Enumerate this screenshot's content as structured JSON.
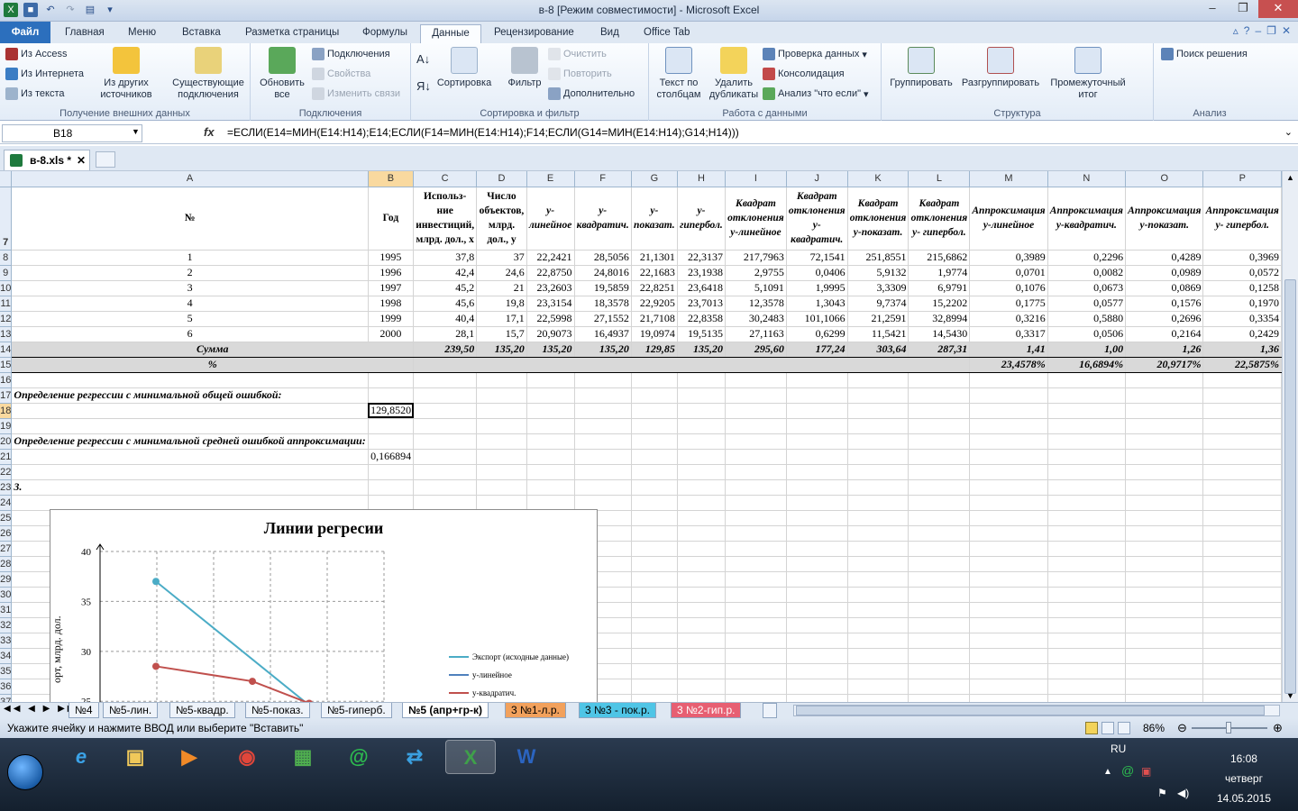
{
  "window": {
    "title": "в-8  [Режим совместимости] - Microsoft Excel"
  },
  "ribbon_tabs": [
    "Файл",
    "Главная",
    "Меню",
    "Вставка",
    "Разметка страницы",
    "Формулы",
    "Данные",
    "Рецензирование",
    "Вид",
    "Office Tab"
  ],
  "ribbon": {
    "ext_data": {
      "access": "Из Access",
      "web": "Из Интернета",
      "text": "Из текста",
      "other": "Из других источников",
      "existing": "Существующие подключения",
      "label": "Получение внешних данных"
    },
    "connections": {
      "refresh": "Обновить все",
      "conn": "Подключения",
      "props": "Свойства",
      "edit": "Изменить связи",
      "label": "Подключения"
    },
    "sortfilter": {
      "sort": "Сортировка",
      "filter": "Фильтр",
      "clear": "Очистить",
      "reapply": "Повторить",
      "advanced": "Дополнительно",
      "label": "Сортировка и фильтр"
    },
    "datatools": {
      "text_cols": "Текст по столбцам",
      "dups": "Удалить дубликаты",
      "validation": "Проверка данных",
      "consolidate": "Консолидация",
      "whatif": "Анализ \"что если\"",
      "label": "Работа с данными"
    },
    "outline": {
      "group": "Группировать",
      "ungroup": "Разгруппировать",
      "subtotal": "Промежуточный итог",
      "label": "Структура"
    },
    "analysis": {
      "solver": "Поиск решения",
      "label": "Анализ"
    }
  },
  "formula_bar": {
    "name_box": "B18",
    "fx": "fx",
    "formula": "=ЕСЛИ(E14=МИН(E14:H14);E14;ЕСЛИ(F14=МИН(E14:H14);F14;ЕСЛИ(G14=МИН(E14:H14);G14;H14)))"
  },
  "workbook_tab": "в-8.xls *",
  "columns": [
    "A",
    "B",
    "C",
    "D",
    "E",
    "F",
    "G",
    "H",
    "I",
    "J",
    "K",
    "L",
    "M",
    "N",
    "O",
    "P"
  ],
  "header_row": {
    "num": "7",
    "cells": [
      "№",
      "Год",
      "Использ-ние инвестиций, млрд. дол., x",
      "Число объектов, млрд. дол., y",
      "y-линейное",
      "y-квадратич.",
      "y-показат.",
      "y- гипербол.",
      "Квадрат отклонения y-линейное",
      "Квадрат отклонения y-квадратич.",
      "Квадрат отклонения y-показат.",
      "Квадрат отклонения y- гипербол.",
      "Аппроксимация y-линейное",
      "Аппроксимация y-квадратич.",
      "Аппроксимация y-показат.",
      "Аппроксимация y- гипербол."
    ]
  },
  "data_rows": [
    {
      "num": "8",
      "cells": [
        "1",
        "1995",
        "37,8",
        "37",
        "22,2421",
        "28,5056",
        "21,1301",
        "22,3137",
        "217,7963",
        "72,1541",
        "251,8551",
        "215,6862",
        "0,3989",
        "0,2296",
        "0,4289",
        "0,3969"
      ]
    },
    {
      "num": "9",
      "cells": [
        "2",
        "1996",
        "42,4",
        "24,6",
        "22,8750",
        "24,8016",
        "22,1683",
        "23,1938",
        "2,9755",
        "0,0406",
        "5,9132",
        "1,9774",
        "0,0701",
        "0,0082",
        "0,0989",
        "0,0572"
      ]
    },
    {
      "num": "10",
      "cells": [
        "3",
        "1997",
        "45,2",
        "21",
        "23,2603",
        "19,5859",
        "22,8251",
        "23,6418",
        "5,1091",
        "1,9995",
        "3,3309",
        "6,9791",
        "0,1076",
        "0,0673",
        "0,0869",
        "0,1258"
      ]
    },
    {
      "num": "11",
      "cells": [
        "4",
        "1998",
        "45,6",
        "19,8",
        "23,3154",
        "18,3578",
        "22,9205",
        "23,7013",
        "12,3578",
        "1,3043",
        "9,7374",
        "15,2202",
        "0,1775",
        "0,0577",
        "0,1576",
        "0,1970"
      ]
    },
    {
      "num": "12",
      "cells": [
        "5",
        "1999",
        "40,4",
        "17,1",
        "22,5998",
        "27,1552",
        "21,7108",
        "22,8358",
        "30,2483",
        "101,1066",
        "21,2591",
        "32,8994",
        "0,3216",
        "0,5880",
        "0,2696",
        "0,3354"
      ]
    },
    {
      "num": "13",
      "cells": [
        "6",
        "2000",
        "28,1",
        "15,7",
        "20,9073",
        "16,4937",
        "19,0974",
        "19,5135",
        "27,1163",
        "0,6299",
        "11,5421",
        "14,5430",
        "0,3317",
        "0,0506",
        "0,2164",
        "0,2429"
      ]
    }
  ],
  "sum_row": {
    "num": "14",
    "label": "Сумма",
    "cells": [
      "239,50",
      "135,20",
      "135,20",
      "135,20",
      "129,85",
      "135,20",
      "295,60",
      "177,24",
      "303,64",
      "287,31",
      "1,41",
      "1,00",
      "1,26",
      "1,36"
    ]
  },
  "pct_row": {
    "num": "15",
    "label": "%",
    "cells": [
      "23,4578%",
      "16,6894%",
      "20,9717%",
      "22,5875%"
    ]
  },
  "notes": {
    "r17": "Определение регрессии с минимальной общей ошибкой:",
    "r18": "129,8520",
    "r20": "Определение регрессии с минимальной средней ошибкой аппроксимации:",
    "r21": "0,166894",
    "r23": "3."
  },
  "row_numbers_tail": [
    "16",
    "17",
    "18",
    "19",
    "20",
    "21",
    "22",
    "23",
    "24",
    "25",
    "26",
    "27",
    "28",
    "29",
    "30",
    "31",
    "32",
    "33",
    "34",
    "35",
    "36",
    "37"
  ],
  "chart_data": {
    "type": "line",
    "title": "Линии регресии",
    "ylabel": "орт, млрд. дол.",
    "yticks": [
      "40",
      "35",
      "30",
      "25"
    ],
    "ylim": [
      25,
      40
    ],
    "series": [
      {
        "name": "Экспорт (исходные данные)",
        "color": "#4bacc6",
        "values": [
          37,
          24.6
        ]
      },
      {
        "name": "y-линейное",
        "color": "#4f81bd",
        "values": []
      },
      {
        "name": "y-квадратич.",
        "color": "#c0504d",
        "values": [
          28.5,
          27,
          24.8
        ]
      }
    ]
  },
  "sheet_tabs": [
    "№4",
    "№5-лин.",
    "№5-квадр.",
    "№5-показ.",
    "№5-гиперб.",
    "№5 (апр+гр-к)",
    "3 №1-л.р.",
    "3 №3 - пок.р.",
    "3 №2-гип.р."
  ],
  "status": {
    "text": "Укажите ячейку и нажмите ВВОД или выберите \"Вставить\"",
    "zoom": "86%"
  },
  "taskbar": {
    "lang": "RU",
    "time": "16:08",
    "day": "четверг",
    "date": "14.05.2015"
  }
}
